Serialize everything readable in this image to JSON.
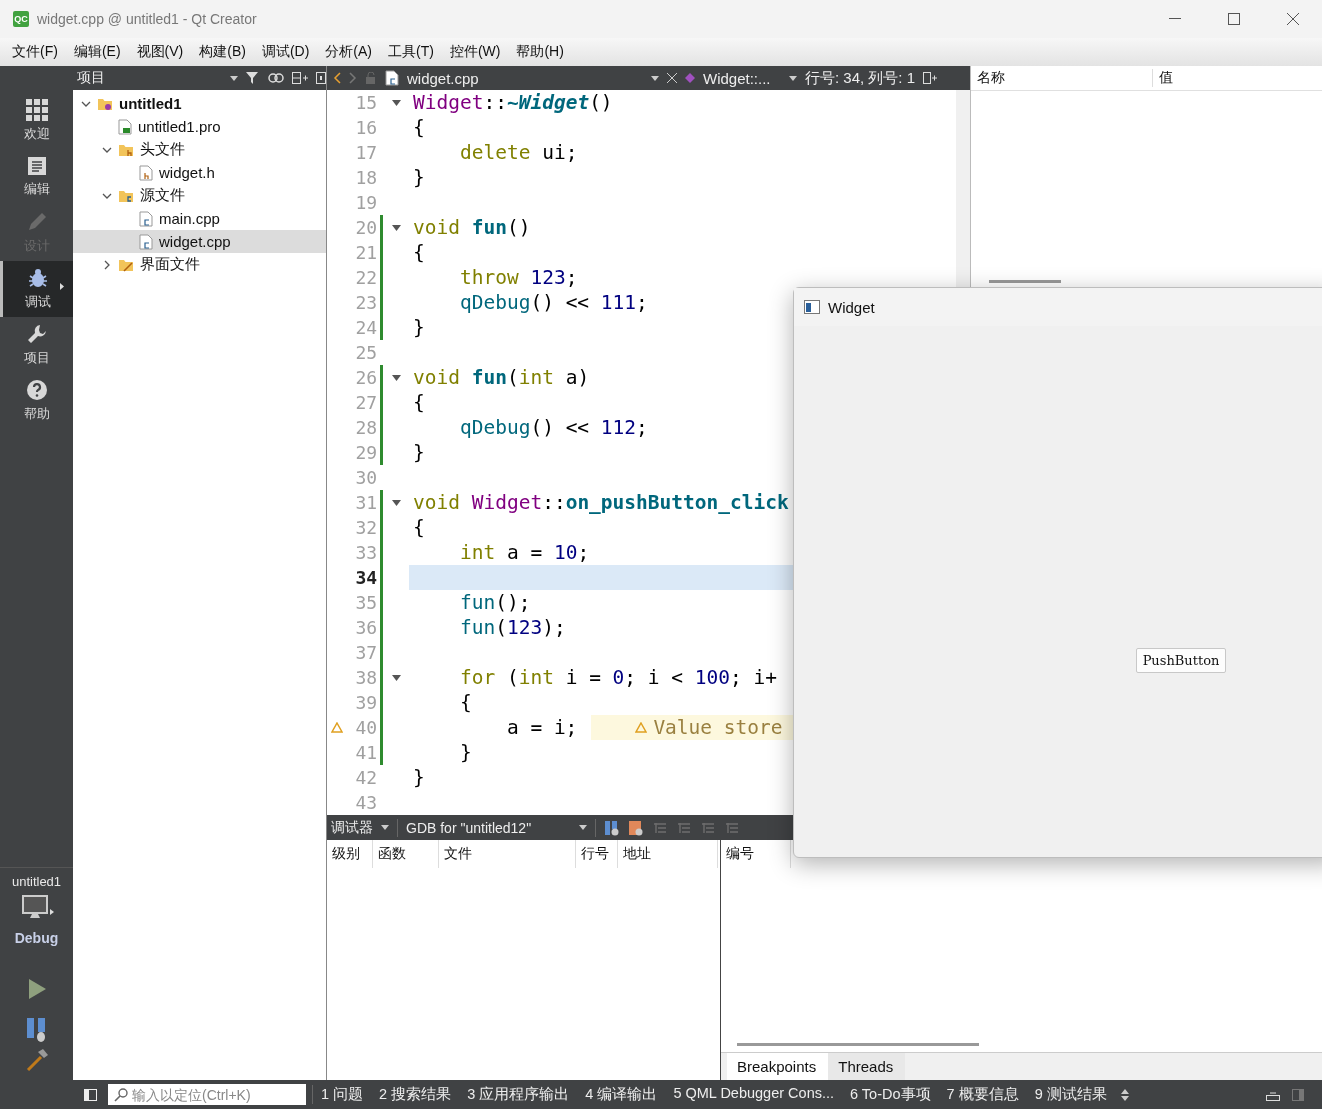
{
  "window": {
    "app_icon": "QC",
    "title": "widget.cpp @ untitled1 - Qt Creator"
  },
  "menu": [
    "文件(F)",
    "编辑(E)",
    "视图(V)",
    "构建(B)",
    "调试(D)",
    "分析(A)",
    "工具(T)",
    "控件(W)",
    "帮助(H)"
  ],
  "modes": [
    {
      "label": "欢迎",
      "selected": false,
      "disabled": false
    },
    {
      "label": "编辑",
      "selected": false,
      "disabled": false
    },
    {
      "label": "设计",
      "selected": false,
      "disabled": true
    },
    {
      "label": "调试",
      "selected": true,
      "disabled": false
    },
    {
      "label": "项目",
      "selected": false,
      "disabled": false
    },
    {
      "label": "帮助",
      "selected": false,
      "disabled": false
    }
  ],
  "target": {
    "project": "untitled1",
    "config": "Debug"
  },
  "project_panel": {
    "title": "项目",
    "tree": [
      {
        "label": "untitled1",
        "kind": "project",
        "expanded": true,
        "selected": false,
        "children": [
          {
            "label": "untitled1.pro",
            "kind": "pro",
            "selected": false
          },
          {
            "label": "头文件",
            "kind": "folder-h",
            "expanded": true,
            "selected": false,
            "children": [
              {
                "label": "widget.h",
                "kind": "header",
                "selected": false
              }
            ]
          },
          {
            "label": "源文件",
            "kind": "folder-src",
            "expanded": true,
            "selected": false,
            "children": [
              {
                "label": "main.cpp",
                "kind": "source",
                "selected": false
              },
              {
                "label": "widget.cpp",
                "kind": "source",
                "selected": true
              }
            ]
          },
          {
            "label": "界面文件",
            "kind": "folder-ui",
            "expanded": false,
            "selected": false
          }
        ]
      }
    ]
  },
  "editor": {
    "file": "widget.cpp",
    "symbol": "Widget::...",
    "position": "行号: 34, 列号: 1",
    "lines": [
      {
        "number": "15",
        "fold": true,
        "current": false,
        "warning": false,
        "changed": false,
        "tokens": [
          {
            "kind": "cls",
            "text": "Widget"
          },
          {
            "kind": "plain",
            "text": "::"
          },
          {
            "kind": "dtor",
            "text": "~Widget"
          },
          {
            "kind": "plain",
            "text": "()"
          }
        ]
      },
      {
        "number": "16",
        "fold": false,
        "current": false,
        "warning": false,
        "changed": false,
        "tokens": [
          {
            "kind": "plain",
            "text": "{"
          }
        ]
      },
      {
        "number": "17",
        "fold": false,
        "current": false,
        "warning": false,
        "changed": false,
        "tokens": [
          {
            "kind": "kw",
            "text": "    delete"
          },
          {
            "kind": "plain",
            "text": " ui;"
          }
        ]
      },
      {
        "number": "18",
        "fold": false,
        "current": false,
        "warning": false,
        "changed": false,
        "tokens": [
          {
            "kind": "plain",
            "text": "}"
          }
        ]
      },
      {
        "number": "19",
        "fold": false,
        "current": false,
        "warning": false,
        "changed": false
      },
      {
        "number": "20",
        "fold": true,
        "current": false,
        "warning": false,
        "changed": true,
        "tokens": [
          {
            "kind": "kw",
            "text": "void "
          },
          {
            "kind": "fn",
            "text": "fun"
          },
          {
            "kind": "plain",
            "text": "()"
          }
        ]
      },
      {
        "number": "21",
        "fold": false,
        "current": false,
        "warning": false,
        "changed": true,
        "tokens": [
          {
            "kind": "plain",
            "text": "{"
          }
        ]
      },
      {
        "number": "22",
        "fold": false,
        "current": false,
        "warning": false,
        "changed": true,
        "tokens": [
          {
            "kind": "kw",
            "text": "    throw "
          },
          {
            "kind": "num",
            "text": "123"
          },
          {
            "kind": "plain",
            "text": ";"
          }
        ]
      },
      {
        "number": "23",
        "fold": false,
        "current": false,
        "warning": false,
        "changed": true,
        "tokens": [
          {
            "kind": "call",
            "text": "    qDebug"
          },
          {
            "kind": "plain",
            "text": "() << "
          },
          {
            "kind": "num",
            "text": "111"
          },
          {
            "kind": "plain",
            "text": ";"
          }
        ]
      },
      {
        "number": "24",
        "fold": false,
        "current": false,
        "warning": false,
        "changed": true,
        "tokens": [
          {
            "kind": "plain",
            "text": "}"
          }
        ]
      },
      {
        "number": "25",
        "fold": false,
        "current": false,
        "warning": false,
        "changed": false
      },
      {
        "number": "26",
        "fold": true,
        "current": false,
        "warning": false,
        "changed": true,
        "tokens": [
          {
            "kind": "kw",
            "text": "void "
          },
          {
            "kind": "fn",
            "text": "fun"
          },
          {
            "kind": "plain",
            "text": "("
          },
          {
            "kind": "kw",
            "text": "int"
          },
          {
            "kind": "plain",
            "text": " a)"
          }
        ]
      },
      {
        "number": "27",
        "fold": false,
        "current": false,
        "warning": false,
        "changed": true,
        "tokens": [
          {
            "kind": "plain",
            "text": "{"
          }
        ]
      },
      {
        "number": "28",
        "fold": false,
        "current": false,
        "warning": false,
        "changed": true,
        "tokens": [
          {
            "kind": "call",
            "text": "    qDebug"
          },
          {
            "kind": "plain",
            "text": "() << "
          },
          {
            "kind": "num",
            "text": "112"
          },
          {
            "kind": "plain",
            "text": ";"
          }
        ]
      },
      {
        "number": "29",
        "fold": false,
        "current": false,
        "warning": false,
        "changed": true,
        "tokens": [
          {
            "kind": "plain",
            "text": "}"
          }
        ]
      },
      {
        "number": "30",
        "fold": false,
        "current": false,
        "warning": false,
        "changed": false
      },
      {
        "number": "31",
        "fold": true,
        "current": false,
        "warning": false,
        "changed": true,
        "tokens": [
          {
            "kind": "kw",
            "text": "void "
          },
          {
            "kind": "cls",
            "text": "Widget"
          },
          {
            "kind": "plain",
            "text": "::"
          },
          {
            "kind": "fn",
            "text": "on_pushButton_click"
          }
        ]
      },
      {
        "number": "32",
        "fold": false,
        "current": false,
        "warning": false,
        "changed": true,
        "tokens": [
          {
            "kind": "plain",
            "text": "{"
          }
        ]
      },
      {
        "number": "33",
        "fold": false,
        "current": false,
        "warning": false,
        "changed": true,
        "tokens": [
          {
            "kind": "kw",
            "text": "    int"
          },
          {
            "kind": "plain",
            "text": " a = "
          },
          {
            "kind": "num",
            "text": "10"
          },
          {
            "kind": "plain",
            "text": ";"
          }
        ]
      },
      {
        "number": "34",
        "fold": false,
        "current": true,
        "warning": false,
        "changed": true
      },
      {
        "number": "35",
        "fold": false,
        "current": false,
        "warning": false,
        "changed": true,
        "tokens": [
          {
            "kind": "call",
            "text": "    fun"
          },
          {
            "kind": "plain",
            "text": "();"
          }
        ]
      },
      {
        "number": "36",
        "fold": false,
        "current": false,
        "warning": false,
        "changed": true,
        "tokens": [
          {
            "kind": "call",
            "text": "    fun"
          },
          {
            "kind": "plain",
            "text": "("
          },
          {
            "kind": "num",
            "text": "123"
          },
          {
            "kind": "plain",
            "text": ");"
          }
        ]
      },
      {
        "number": "37",
        "fold": false,
        "current": false,
        "warning": false,
        "changed": true
      },
      {
        "number": "38",
        "fold": true,
        "current": false,
        "warning": false,
        "changed": true,
        "tokens": [
          {
            "kind": "kw",
            "text": "    for"
          },
          {
            "kind": "plain",
            "text": " ("
          },
          {
            "kind": "kw",
            "text": "int"
          },
          {
            "kind": "plain",
            "text": " i = "
          },
          {
            "kind": "num",
            "text": "0"
          },
          {
            "kind": "plain",
            "text": "; i < "
          },
          {
            "kind": "num",
            "text": "100"
          },
          {
            "kind": "plain",
            "text": "; i+"
          }
        ]
      },
      {
        "number": "39",
        "fold": false,
        "current": false,
        "warning": false,
        "changed": true,
        "tokens": [
          {
            "kind": "plain",
            "text": "    {"
          }
        ]
      },
      {
        "number": "40",
        "fold": false,
        "current": false,
        "warning": true,
        "changed": true,
        "tokens": [
          {
            "kind": "plain",
            "text": "        a = i;"
          }
        ],
        "annotation": "Value store"
      },
      {
        "number": "41",
        "fold": false,
        "current": false,
        "warning": false,
        "changed": true,
        "tokens": [
          {
            "kind": "plain",
            "text": "    }"
          }
        ]
      },
      {
        "number": "42",
        "fold": false,
        "current": false,
        "warning": false,
        "changed": false,
        "tokens": [
          {
            "kind": "plain",
            "text": "}"
          }
        ]
      },
      {
        "number": "43",
        "fold": false,
        "current": false,
        "warning": false,
        "changed": false
      }
    ]
  },
  "locals": {
    "columns": [
      "名称",
      "值"
    ]
  },
  "debugger": {
    "label": "调试器",
    "engine": "GDB for \"untitled12\""
  },
  "stack": {
    "columns": [
      "级别",
      "函数",
      "文件",
      "行号",
      "地址"
    ]
  },
  "breakpoints": {
    "columns": [
      "编号"
    ],
    "tabs": [
      {
        "label": "Breakpoints",
        "selected": true
      },
      {
        "label": "Threads",
        "selected": false
      }
    ]
  },
  "status_bar": {
    "search_placeholder": "输入以定位(Ctrl+K)",
    "panes": [
      "1 问题",
      "2 搜索结果",
      "3 应用程序输出",
      "4 编译输出",
      "5 QML Debugger Cons...",
      "6 To-Do事项",
      "7 概要信息",
      "9 测试结果"
    ]
  },
  "widget_window": {
    "title": "Widget",
    "button": "PushButton"
  }
}
